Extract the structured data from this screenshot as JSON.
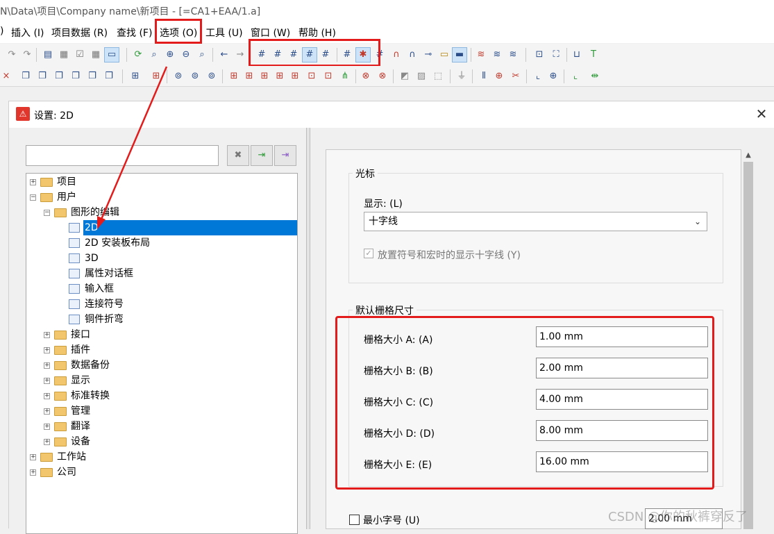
{
  "window": {
    "title": "N\\Data\\项目\\Company name\\新项目 - [=CA1+EAA/1.a]"
  },
  "menu": {
    "items": [
      {
        "label": ")"
      },
      {
        "label": "插入 (I)"
      },
      {
        "label": "项目数据 (R)"
      },
      {
        "label": "查找 (F)"
      },
      {
        "label": "选项 (O)"
      },
      {
        "label": "工具 (U)"
      },
      {
        "label": "窗口 (W)"
      },
      {
        "label": "帮助 (H)"
      }
    ]
  },
  "toolbar": {
    "grid_buttons": [
      "grid-a-icon",
      "grid-b-icon",
      "grid-c-icon",
      "grid-d-icon",
      "grid-e-icon",
      "grid-toggle-icon",
      "grid-snap-icon"
    ]
  },
  "dialog": {
    "title": "设置: 2D",
    "search": {
      "value": ""
    },
    "tree": [
      {
        "label": "项目",
        "level": 0,
        "expanded": false
      },
      {
        "label": "用户",
        "level": 0,
        "expanded": true
      },
      {
        "label": "图形的编辑",
        "level": 1,
        "expanded": true
      },
      {
        "label": "2D",
        "level": 2,
        "selected": true
      },
      {
        "label": "2D 安装板布局",
        "level": 2
      },
      {
        "label": "3D",
        "level": 2
      },
      {
        "label": "属性对话框",
        "level": 2
      },
      {
        "label": "输入框",
        "level": 2
      },
      {
        "label": "连接符号",
        "level": 2
      },
      {
        "label": "铜件折弯",
        "level": 2
      },
      {
        "label": "接口",
        "level": 1
      },
      {
        "label": "插件",
        "level": 1
      },
      {
        "label": "数据备份",
        "level": 1
      },
      {
        "label": "显示",
        "level": 1
      },
      {
        "label": "标准转换",
        "level": 1
      },
      {
        "label": "管理",
        "level": 1
      },
      {
        "label": "翻译",
        "level": 1
      },
      {
        "label": "设备",
        "level": 1
      },
      {
        "label": "工作站",
        "level": 0
      },
      {
        "label": "公司",
        "level": 0
      }
    ],
    "cursor_group": {
      "title": "光标",
      "display_label": "显示: (L)",
      "display_value": "十字线",
      "crosshair_checkbox_label": "放置符号和宏时的显示十字线 (Y)",
      "crosshair_checked": true
    },
    "grid_group": {
      "title": "默认栅格尺寸",
      "rows": [
        {
          "label": "栅格大小 A: (A)",
          "value": "1.00 mm"
        },
        {
          "label": "栅格大小 B: (B)",
          "value": "2.00 mm"
        },
        {
          "label": "栅格大小 C: (C)",
          "value": "4.00 mm"
        },
        {
          "label": "栅格大小 D: (D)",
          "value": "8.00 mm"
        },
        {
          "label": "栅格大小 E: (E)",
          "value": "16.00 mm"
        }
      ]
    },
    "min_font": {
      "label": "最小字号 (U)",
      "value": "2.00 mm",
      "checked": false
    }
  },
  "watermark": "CSDN @你的秋裤穿反了",
  "colors": {
    "highlight": "#e31b1b",
    "selection": "#0078d7"
  }
}
